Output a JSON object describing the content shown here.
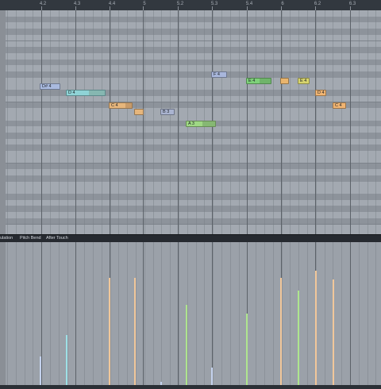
{
  "ruler": {
    "ticks": [
      "4.2",
      "4.3",
      "4.4",
      "5",
      "5.2",
      "5.3",
      "5.4",
      "6",
      "6.2",
      "6.3"
    ]
  },
  "notes": [
    {
      "label": "D# 4",
      "color": "#9fb3d9"
    },
    {
      "label": "D 4",
      "color": "#8fd3d6"
    },
    {
      "label": "C 4",
      "color": "#e6b67c"
    },
    {
      "label": "",
      "color": "#e6b67c"
    },
    {
      "label": "B 3",
      "color": "#a9b3cf"
    },
    {
      "label": "A 3",
      "color": "#9fd884"
    },
    {
      "label": "F 4",
      "color": "#a8b6db"
    },
    {
      "label": "E 4",
      "color": "#7ed17a"
    },
    {
      "label": "",
      "color": "#e9b56e"
    },
    {
      "label": "E 4",
      "color": "#d7d46e"
    },
    {
      "label": "D 4",
      "color": "#f0b472"
    },
    {
      "label": "C 4",
      "color": "#f0b472"
    }
  ],
  "tabs": {
    "modulation": "ulation",
    "pitch_bend": "Pitch Bend",
    "after_touch": "After Touch"
  },
  "velocity": {
    "levels": [
      0.2,
      0.35,
      0.75,
      0.75,
      0.02,
      0.56,
      0.12,
      0.5,
      0.75,
      0.66,
      0.8,
      0.74
    ]
  },
  "colors": {
    "bg": "#3a3f46",
    "roll": "#9ea4ac",
    "stem_blue": "#c4d2ee",
    "stem_cyan": "#9ee0e6",
    "stem_orange": "#f1c79a",
    "stem_green": "#aee58e"
  }
}
